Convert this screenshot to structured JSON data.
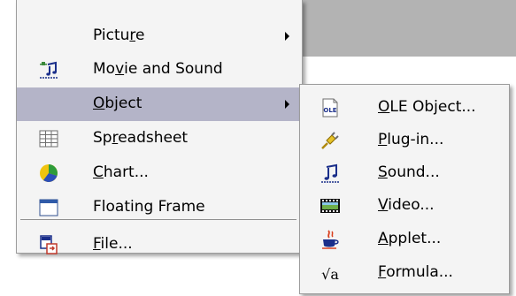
{
  "menu": {
    "items": [
      {
        "label_pre": "Pictu",
        "label_mn": "r",
        "label_post": "e",
        "has_submenu": true,
        "icon": "none"
      },
      {
        "label_pre": "Mo",
        "label_mn": "v",
        "label_post": "ie and Sound",
        "has_submenu": false,
        "icon": "movie-sound-icon"
      },
      {
        "label_pre": "",
        "label_mn": "O",
        "label_post": "bject",
        "has_submenu": true,
        "active": true,
        "icon": "none"
      },
      {
        "label_pre": "Sp",
        "label_mn": "r",
        "label_post": "eadsheet",
        "has_submenu": false,
        "icon": "spreadsheet-icon"
      },
      {
        "label_pre": "",
        "label_mn": "C",
        "label_post": "hart...",
        "has_submenu": false,
        "icon": "chart-icon"
      },
      {
        "label_pre": "Floating Frame",
        "label_mn": "",
        "label_post": "",
        "has_submenu": false,
        "icon": "floating-frame-icon"
      },
      {
        "label_pre": "",
        "label_mn": "F",
        "label_post": "ile...",
        "has_submenu": false,
        "icon": "file-icon"
      }
    ]
  },
  "submenu": {
    "items": [
      {
        "label_pre": "",
        "label_mn": "O",
        "label_post": "LE Object...",
        "icon": "ole-object-icon",
        "icon_text": "OLE"
      },
      {
        "label_pre": "",
        "label_mn": "P",
        "label_post": "lug-in...",
        "icon": "plug-in-icon"
      },
      {
        "label_pre": "",
        "label_mn": "S",
        "label_post": "ound...",
        "icon": "sound-icon"
      },
      {
        "label_pre": "",
        "label_mn": "V",
        "label_post": "ideo...",
        "icon": "video-icon"
      },
      {
        "label_pre": "",
        "label_mn": "A",
        "label_post": "pplet...",
        "icon": "applet-icon"
      },
      {
        "label_pre": "",
        "label_mn": "F",
        "label_post": "ormula...",
        "icon": "formula-icon",
        "icon_text": "√a"
      }
    ]
  },
  "colors": {
    "menu_bg": "#f4f4f4",
    "highlight": "#b4b4c8",
    "border": "#9c9c9c"
  }
}
